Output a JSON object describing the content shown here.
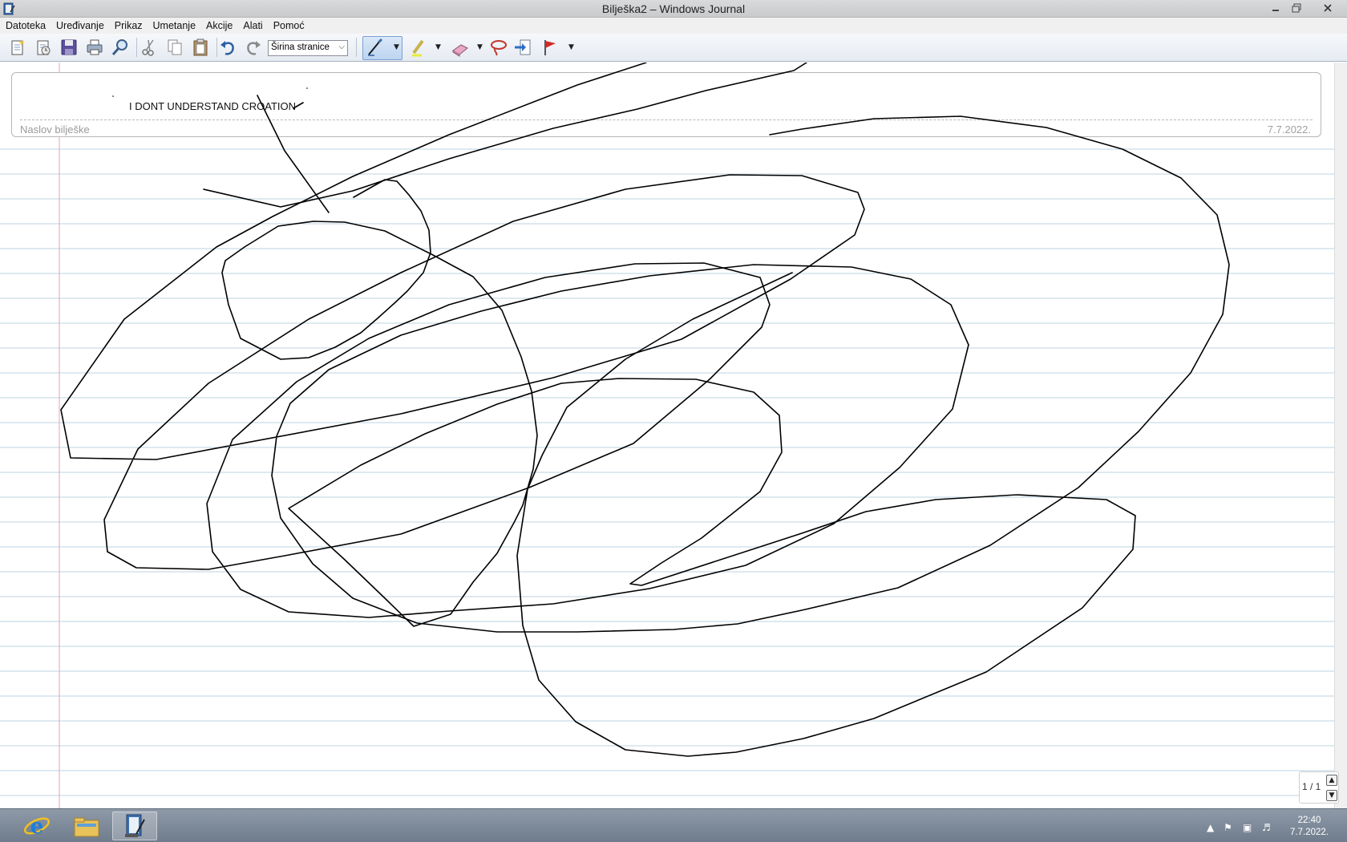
{
  "window": {
    "title": "Bilješka2 – Windows Journal"
  },
  "menu": {
    "items": [
      "Datoteka",
      "Uređivanje",
      "Prikaz",
      "Umetanje",
      "Akcije",
      "Alati",
      "Pomoć"
    ]
  },
  "toolbar": {
    "zoom_value": "Širina stranice",
    "icons": [
      "new-note-icon",
      "open-icon",
      "save-icon",
      "print-icon",
      "find-icon",
      "cut-icon",
      "copy-icon",
      "paste-icon",
      "undo-icon",
      "redo-icon",
      "pen-icon",
      "highlighter-icon",
      "eraser-icon",
      "lasso-select-icon",
      "insert-space-icon",
      "flag-icon"
    ]
  },
  "note": {
    "title_placeholder": "Naslov bilješke",
    "date": "7.7.2022.",
    "handwritten_text": "I DONT UNDERSTAND CROATION"
  },
  "pager": {
    "label": "1 / 1"
  },
  "taskbar": {
    "apps": [
      "internet-explorer-icon",
      "file-explorer-icon",
      "windows-journal-icon"
    ],
    "clock_time": "22:40",
    "clock_date": "7.7.2022."
  },
  "colors": {
    "ruling_line": "#bcd3e0",
    "margin_line": "#e3a4b3",
    "ink": "#000000"
  }
}
